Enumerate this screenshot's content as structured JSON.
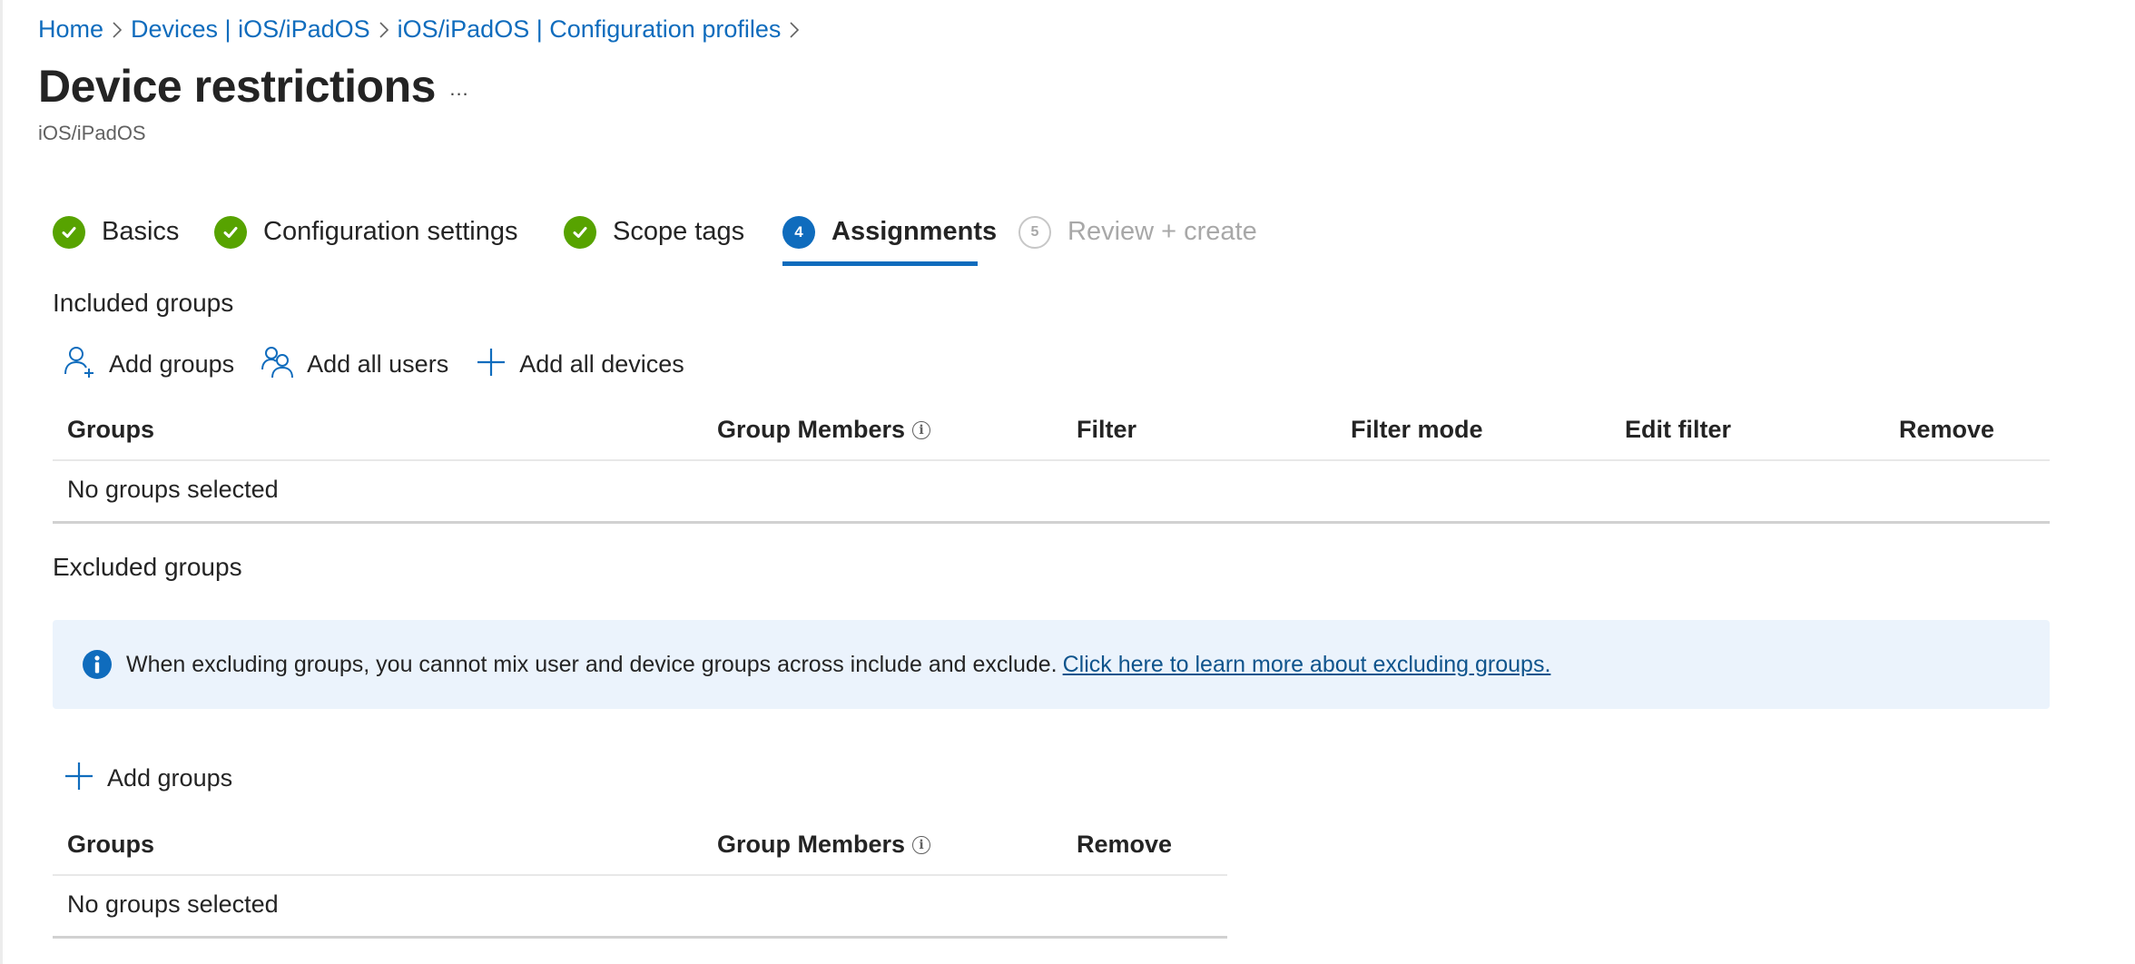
{
  "breadcrumb": [
    {
      "label": "Home"
    },
    {
      "label": "Devices | iOS/iPadOS"
    },
    {
      "label": "iOS/iPadOS | Configuration profiles"
    }
  ],
  "page": {
    "title": "Device restrictions",
    "more_label": "...",
    "subtitle": "iOS/iPadOS"
  },
  "wizard": {
    "steps": [
      {
        "number": "1",
        "label": "Basics",
        "state": "done"
      },
      {
        "number": "2",
        "label": "Configuration settings",
        "state": "done"
      },
      {
        "number": "3",
        "label": "Scope tags",
        "state": "done"
      },
      {
        "number": "4",
        "label": "Assignments",
        "state": "current"
      },
      {
        "number": "5",
        "label": "Review + create",
        "state": "todo"
      }
    ]
  },
  "included": {
    "title": "Included groups",
    "toolbar": {
      "add_groups": "Add groups",
      "add_all_users": "Add all users",
      "add_all_devices": "Add all devices"
    },
    "columns": [
      "Groups",
      "Group Members",
      "Filter",
      "Filter mode",
      "Edit filter",
      "Remove"
    ],
    "empty_text": "No groups selected"
  },
  "excluded": {
    "title": "Excluded groups",
    "banner": {
      "text": "When excluding groups, you cannot mix user and device groups across include and exclude.",
      "link": "Click here to learn more about excluding groups."
    },
    "add_groups": "Add groups",
    "columns": [
      "Groups",
      "Group Members",
      "Remove"
    ],
    "empty_text": "No groups selected"
  },
  "colors": {
    "accent": "#0f6cbd",
    "success": "#57a300",
    "banner_bg": "#ebf3fc",
    "link_dark": "#0f548c",
    "disabled": "#a8a8a8"
  }
}
